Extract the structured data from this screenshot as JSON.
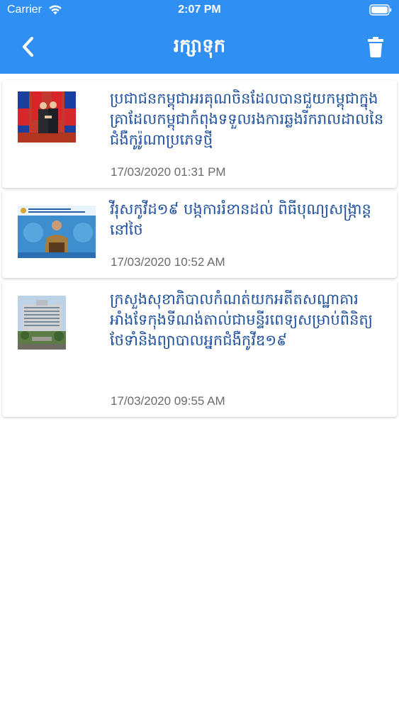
{
  "status_bar": {
    "carrier": "Carrier",
    "time": "2:07 PM"
  },
  "nav": {
    "title": "រក្សាទុក",
    "back_icon": "chevron-left-icon",
    "delete_icon": "trash-icon"
  },
  "colors": {
    "header": "#2f8ff3",
    "title_text": "#1e4f9c",
    "date_text": "#6b6b6b"
  },
  "articles": [
    {
      "title": "ប្រជាជនកម្ពុជាអរគុណចិនដែលបានជួយកម្ពុជាក្នុងគ្រាដែលកម្ពុជាកំពុងទទួលរងការឆ្លងរីករាលដាលនៃជំងឺកូរ៉ូណាប្រភេទថ្មី",
      "date": "17/03/2020 01:31 PM",
      "thumbnail": "leaders-handshake-photo"
    },
    {
      "title": "វីរុសកូវីដ១៩ បង្កការរំខានដល់ ពិធីបុណ្យសង្ក្រាន្តនៅថៃ",
      "date": "17/03/2020 10:52 AM",
      "thumbnail": "press-conference-photo"
    },
    {
      "title": "ក្រសួងសុខាភិបាលកំណត់យកអតីតសណ្ឋាគារអាំងទែកុងទីណង់តាល់ជាមន្ទីរពេទ្យសម្រាប់ពិនិត្យ ថែទាំនិងព្យាបាលអ្នកជំងឺកូវីឌ១៩",
      "date": "17/03/2020 09:55 AM",
      "thumbnail": "hotel-building-photo"
    }
  ]
}
